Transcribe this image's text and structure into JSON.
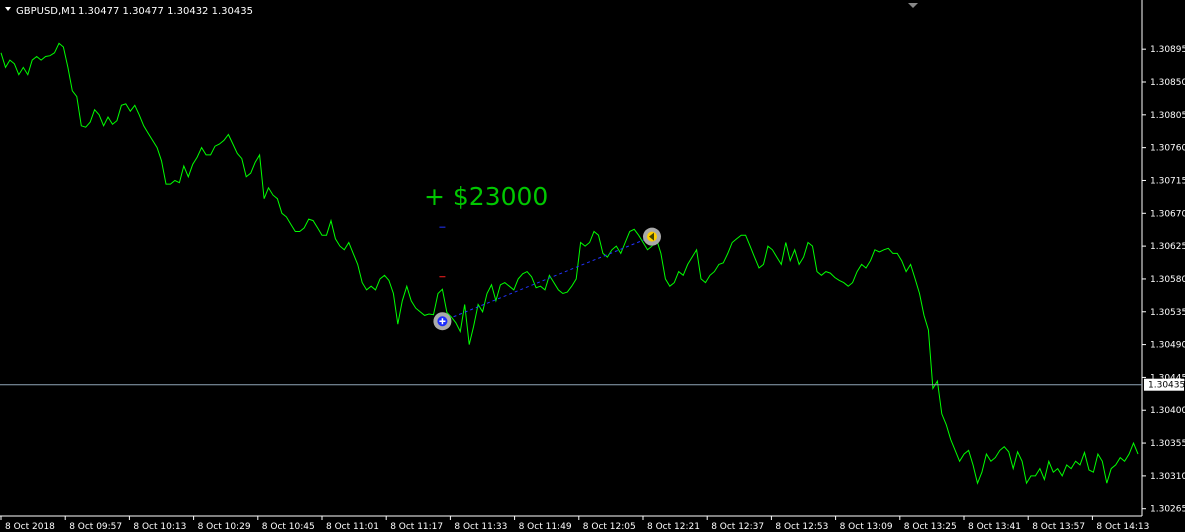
{
  "header": {
    "menu_icon": "triangle-down-icon",
    "symbol": "GBPUSD,M1",
    "ohlc": "1.30477 1.30477 1.30432 1.30435"
  },
  "colors": {
    "background": "#000000",
    "price_line": "#00ff00",
    "axis": "#ffffff",
    "current_price_line": "#8fa6b8",
    "trade_line": "#2233ff",
    "entry_marker": "#1a2bff",
    "exit_marker": "#ffd000",
    "profit_text": "#00c800",
    "stop_loss": "#ff2020",
    "take_profit": "#2233ff"
  },
  "profit_label": "+ $23000",
  "current_price": "1.30435",
  "chart_data": {
    "type": "line",
    "title": "GBPUSD,M1",
    "ylim": [
      1.30255,
      1.30935
    ],
    "y_ticks": [
      "1.30895",
      "1.30850",
      "1.30805",
      "1.30760",
      "1.30715",
      "1.30670",
      "1.30625",
      "1.30580",
      "1.30535",
      "1.30490",
      "1.30445",
      "1.30400",
      "1.30355",
      "1.30310",
      "1.30265"
    ],
    "x_ticks": [
      "8 Oct 2018",
      "8 Oct 09:57",
      "8 Oct 10:13",
      "8 Oct 10:29",
      "8 Oct 10:45",
      "8 Oct 11:01",
      "8 Oct 11:17",
      "8 Oct 11:33",
      "8 Oct 11:49",
      "8 Oct 12:05",
      "8 Oct 12:21",
      "8 Oct 12:37",
      "8 Oct 12:53",
      "8 Oct 13:09",
      "8 Oct 13:25",
      "8 Oct 13:41",
      "8 Oct 13:57",
      "8 Oct 14:13"
    ],
    "series": [
      {
        "close": [
          1.3089,
          1.3087,
          1.3088,
          1.30875,
          1.3086,
          1.3087,
          1.3086,
          1.3088,
          1.30885,
          1.3088,
          1.30885,
          1.30886,
          1.3089,
          1.30903,
          1.30898,
          1.3087,
          1.30838,
          1.3083,
          1.3079,
          1.30788,
          1.30795,
          1.30812,
          1.30805,
          1.3079,
          1.30802,
          1.30792,
          1.30797,
          1.30818,
          1.3082,
          1.3081,
          1.30818,
          1.30805,
          1.3079,
          1.3078,
          1.3077,
          1.3076,
          1.30742,
          1.3071,
          1.3071,
          1.30715,
          1.30712,
          1.30735,
          1.3072,
          1.30737,
          1.30747,
          1.3076,
          1.3075,
          1.3075,
          1.30762,
          1.30765,
          1.3077,
          1.30778,
          1.30765,
          1.30752,
          1.30745,
          1.3072,
          1.30725,
          1.3074,
          1.3075,
          1.3069,
          1.30705,
          1.30695,
          1.3069,
          1.3067,
          1.30665,
          1.30655,
          1.30645,
          1.30645,
          1.3065,
          1.30662,
          1.3066,
          1.3065,
          1.3064,
          1.3064,
          1.3066,
          1.30635,
          1.30625,
          1.3062,
          1.3063,
          1.30615,
          1.306,
          1.30575,
          1.30565,
          1.3057,
          1.30565,
          1.3058,
          1.30585,
          1.30578,
          1.3056,
          1.30518,
          1.3055,
          1.3057,
          1.3055,
          1.3054,
          1.30535,
          1.3053,
          1.30532,
          1.30531,
          1.3056,
          1.30566,
          1.30534,
          1.30528,
          1.3052,
          1.30508,
          1.30545,
          1.3049,
          1.30515,
          1.30545,
          1.30535,
          1.3056,
          1.30572,
          1.3055,
          1.30572,
          1.30575,
          1.3057,
          1.30565,
          1.3058,
          1.30587,
          1.3059,
          1.30583,
          1.30568,
          1.3057,
          1.30565,
          1.30585,
          1.30575,
          1.30565,
          1.3056,
          1.30562,
          1.3057,
          1.3058,
          1.3063,
          1.30625,
          1.3063,
          1.30645,
          1.3064,
          1.30615,
          1.3061,
          1.3062,
          1.30625,
          1.30615,
          1.3063,
          1.30645,
          1.30648,
          1.3064,
          1.3063,
          1.3062,
          1.30625,
          1.30635,
          1.30615,
          1.3058,
          1.3057,
          1.30575,
          1.3059,
          1.30585,
          1.306,
          1.3061,
          1.3062,
          1.3058,
          1.30575,
          1.30585,
          1.3059,
          1.306,
          1.30602,
          1.30615,
          1.3063,
          1.30635,
          1.3064,
          1.3064,
          1.30625,
          1.3061,
          1.30595,
          1.306,
          1.30625,
          1.3062,
          1.3061,
          1.306,
          1.3063,
          1.30605,
          1.3062,
          1.306,
          1.3061,
          1.3063,
          1.30625,
          1.3059,
          1.30585,
          1.3059,
          1.30588,
          1.30582,
          1.30578,
          1.30575,
          1.3057,
          1.30575,
          1.3059,
          1.306,
          1.30595,
          1.30605,
          1.3062,
          1.30617,
          1.3062,
          1.30622,
          1.30615,
          1.30615,
          1.30605,
          1.3059,
          1.306,
          1.3058,
          1.3056,
          1.3053,
          1.3051,
          1.3043,
          1.3044,
          1.30395,
          1.3038,
          1.3036,
          1.30345,
          1.3033,
          1.3034,
          1.30345,
          1.30325,
          1.303,
          1.30315,
          1.3034,
          1.3033,
          1.30335,
          1.30345,
          1.3035,
          1.30343,
          1.3032,
          1.30343,
          1.3033,
          1.303,
          1.3031,
          1.3031,
          1.3032,
          1.30305,
          1.3033,
          1.30315,
          1.3032,
          1.3031,
          1.30325,
          1.3032,
          1.3033,
          1.30325,
          1.30342,
          1.30318,
          1.30315,
          1.3034,
          1.3033,
          1.303,
          1.3032,
          1.30325,
          1.30335,
          1.3033,
          1.3034,
          1.30355,
          1.3034
        ]
      }
    ],
    "trade": {
      "entry": {
        "bar": 99,
        "price": 1.30522
      },
      "exit": {
        "bar": 146,
        "price": 1.30638
      },
      "stop_loss": 1.30583,
      "take_profit": 1.30651
    },
    "current_price": 1.30435,
    "grid": false
  }
}
